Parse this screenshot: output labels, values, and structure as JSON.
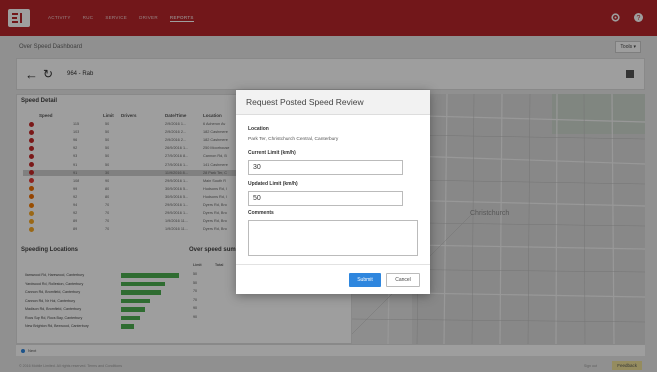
{
  "nav": {
    "items": [
      "ACTIVITY",
      "RUC",
      "SERVICE",
      "DRIVER",
      "REPORTS"
    ],
    "active_index": 4,
    "settings_icon": "gear-icon",
    "help_icon": "help-icon"
  },
  "page": {
    "title": "Over Speed Dashboard",
    "tools_label": "Tools ▾",
    "vehicle": "964 - Rab"
  },
  "speed_detail": {
    "title": "Speed Detail",
    "columns": [
      "Speed",
      "Limit",
      "Drivers",
      "Date/Time",
      "Location"
    ],
    "rows": [
      {
        "color": "#c62828",
        "speed": "115",
        "limit": "50",
        "driver": "",
        "datetime": "2/9/2016 1...",
        "location": "6 Acheron Av"
      },
      {
        "color": "#c62828",
        "speed": "103",
        "limit": "50",
        "driver": "",
        "datetime": "2/9/2016 2...",
        "location": "182 Cashmere"
      },
      {
        "color": "#c62828",
        "speed": "96",
        "limit": "50",
        "driver": "",
        "datetime": "2/9/2016 2...",
        "location": "182 Cashmere"
      },
      {
        "color": "#c62828",
        "speed": "92",
        "limit": "50",
        "driver": "",
        "datetime": "26/9/2016 1...",
        "location": "250 Moorhouse"
      },
      {
        "color": "#c62828",
        "speed": "93",
        "limit": "50",
        "driver": "",
        "datetime": "27/9/2016 8...",
        "location": "Cannon Rd, B"
      },
      {
        "color": "#c62828",
        "speed": "91",
        "limit": "50",
        "driver": "",
        "datetime": "27/9/2016 1...",
        "location": "141 Cashmere"
      },
      {
        "color": "#c62828",
        "speed": "91",
        "limit": "30",
        "driver": "",
        "datetime": "11/9/2016 8...",
        "location": "28 Park Ter, C"
      },
      {
        "color": "#e53935",
        "speed": "108",
        "limit": "90",
        "driver": "",
        "datetime": "29/9/2016 1...",
        "location": "Main South R"
      },
      {
        "color": "#ef6c00",
        "speed": "99",
        "limit": "80",
        "driver": "",
        "datetime": "30/9/2016 5...",
        "location": "Hudsons Rd, I"
      },
      {
        "color": "#ef6c00",
        "speed": "92",
        "limit": "80",
        "driver": "",
        "datetime": "30/9/2016 5...",
        "location": "Hudsons Rd, I"
      },
      {
        "color": "#f57c00",
        "speed": "94",
        "limit": "70",
        "driver": "",
        "datetime": "29/9/2016 1...",
        "location": "Dyers Rd, Bro"
      },
      {
        "color": "#f9a825",
        "speed": "92",
        "limit": "70",
        "driver": "",
        "datetime": "29/9/2016 1...",
        "location": "Dyers Rd, Bro"
      },
      {
        "color": "#f9a825",
        "speed": "89",
        "limit": "70",
        "driver": "",
        "datetime": "1/9/2016 11...",
        "location": "Dyers Rd, Bro"
      },
      {
        "color": "#f9a825",
        "speed": "89",
        "limit": "70",
        "driver": "",
        "datetime": "1/9/2016 11...",
        "location": "Dyers Rd, Bro"
      }
    ],
    "selected_index": 6
  },
  "speeding_locations": {
    "title": "Speeding Locations",
    "rows": [
      {
        "label": "Ilamwood Rd, Harewood, Canterbury",
        "value": 90
      },
      {
        "label": "Yardwood Rd, Rolleston, Canterbury",
        "value": 68
      },
      {
        "label": "Cannon Rd, Bromfield, Canterbury",
        "value": 62
      },
      {
        "label": "Cannon Rd, Nr Hoi, Canterbury",
        "value": 45
      },
      {
        "label": "Madison Rd, Bromfield, Canterbury",
        "value": 38
      },
      {
        "label": "Rocs Sqr Rd, Rocs Bay, Canterbury",
        "value": 30
      },
      {
        "label": "New Brighton Rd, Bexwood, Canterbury",
        "value": 20
      }
    ],
    "bar_color": "#4caf50"
  },
  "over_speed": {
    "title": "Over speed sum",
    "columns": [
      "Limit",
      "Total"
    ],
    "rows": [
      [
        "50",
        ""
      ],
      [
        "50",
        ""
      ],
      [
        "70",
        ""
      ],
      [
        "70",
        ""
      ],
      [
        "90",
        ""
      ],
      [
        "90",
        ""
      ]
    ]
  },
  "map": {
    "label": "Christchurch"
  },
  "footer": {
    "legend": "Next",
    "copyright": "© 2016 Mobile Limited. All rights reserved.   Terms and Conditions",
    "signed_in": "Sign out",
    "feedback": "Feedback"
  },
  "modal": {
    "title": "Request Posted Speed Review",
    "location_label": "Location",
    "location_value": "Park Ter, Christchurch Central, Canterbury",
    "current_limit_label": "Current Limit (km/h)",
    "current_limit_value": "30",
    "updated_limit_label": "Updated Limit (km/h)",
    "updated_limit_value": "50",
    "comments_label": "Comments",
    "comments_value": "",
    "submit_label": "Submit",
    "cancel_label": "Cancel"
  },
  "colors": {
    "brand": "#b8262b",
    "primary_button": "#2e86de"
  }
}
